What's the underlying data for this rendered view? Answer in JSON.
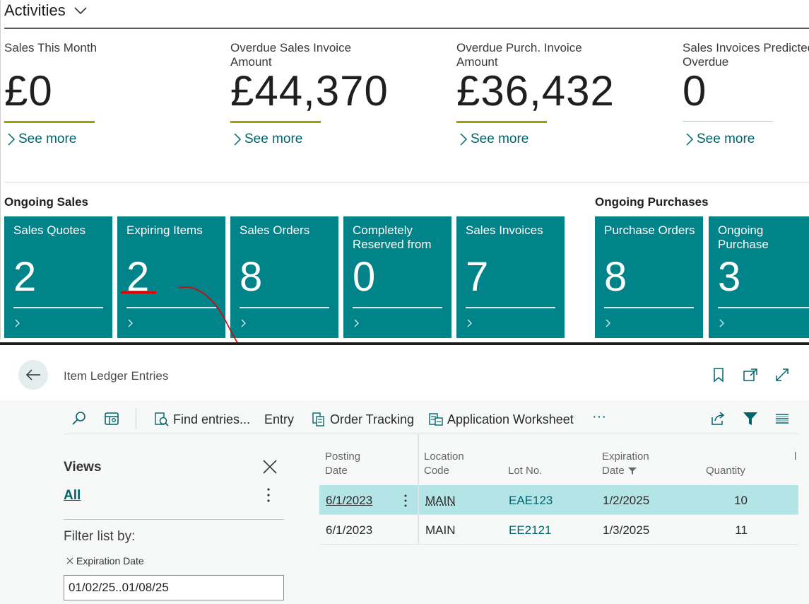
{
  "activities": {
    "title": "Activities",
    "kpis": [
      {
        "label": "Sales This Month",
        "value": "£0",
        "link": "See more"
      },
      {
        "label": "Overdue Sales Invoice Amount",
        "value": "£44,370",
        "link": "See more"
      },
      {
        "label": "Overdue Purch. Invoice Amount",
        "value": "£36,432",
        "link": "See more"
      },
      {
        "label": "Sales Invoices Predicted Overdue",
        "value": "0",
        "link": "See more"
      }
    ]
  },
  "ongoing_sales": {
    "title": "Ongoing Sales",
    "tiles": [
      {
        "label": "Sales Quotes",
        "value": "2"
      },
      {
        "label": "Expiring Items",
        "value": "2"
      },
      {
        "label": "Sales Orders",
        "value": "8"
      },
      {
        "label": "Completely Reserved from Stock",
        "value": "0"
      },
      {
        "label": "Sales Invoices",
        "value": "7"
      }
    ]
  },
  "ongoing_purchases": {
    "title": "Ongoing Purchases",
    "tiles": [
      {
        "label": "Purchase Orders",
        "value": "8"
      },
      {
        "label": "Ongoing Purchase Invoices",
        "value": "3"
      }
    ]
  },
  "page": {
    "caption": "Item Ledger Entries",
    "actions": {
      "find_entries": "Find entries...",
      "entry": "Entry",
      "order_tracking": "Order Tracking",
      "application_worksheet": "Application Worksheet",
      "more": "···"
    }
  },
  "filter_pane": {
    "views_title": "Views",
    "view_all": "All",
    "filter_title": "Filter list by:",
    "field_label": "Expiration Date",
    "field_value": "01/02/25..01/08/25"
  },
  "grid": {
    "columns": {
      "posting_date": "Posting Date",
      "location_code": "Location Code",
      "lot_no": "Lot No.",
      "expiration_date": "Expiration Date",
      "quantity": "Quantity"
    },
    "rows": [
      {
        "posting_date": "6/1/2023",
        "location_code": "MAIN",
        "lot_no": "EAE123",
        "expiration_date": "1/2/2025",
        "quantity": "10"
      },
      {
        "posting_date": "6/1/2023",
        "location_code": "MAIN",
        "lot_no": "EE2121",
        "expiration_date": "1/3/2025",
        "quantity": "11"
      }
    ]
  },
  "colors": {
    "tile_bg": "#00848a",
    "link": "#00646b",
    "kpi_bar": "#a0a000",
    "selected_row": "#b3e4e6",
    "annotation": "#e00000"
  }
}
